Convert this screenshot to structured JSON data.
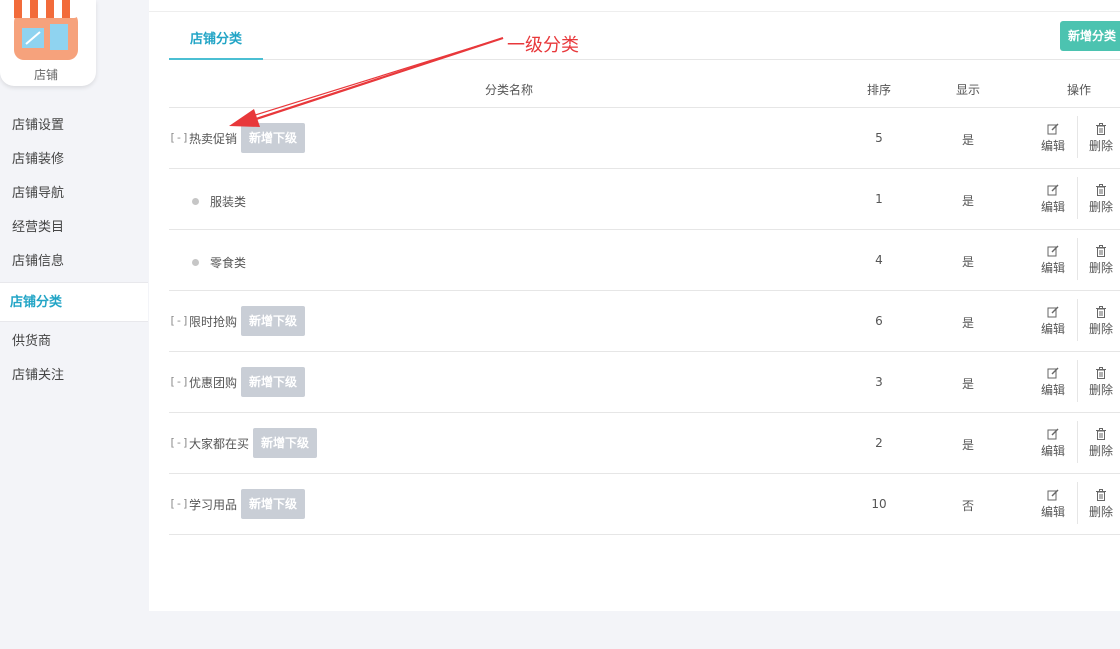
{
  "sidebar": {
    "shop_name": "店铺",
    "items": [
      {
        "label": "店铺设置",
        "active": false
      },
      {
        "label": "店铺装修",
        "active": false
      },
      {
        "label": "店铺导航",
        "active": false
      },
      {
        "label": "经营类目",
        "active": false
      },
      {
        "label": "店铺信息",
        "active": false
      },
      {
        "label": "店铺分类",
        "active": true
      },
      {
        "label": "供货商",
        "active": false
      },
      {
        "label": "店铺关注",
        "active": false
      }
    ]
  },
  "main": {
    "tab_label": "店铺分类",
    "add_category_button": "新增分类",
    "annotation": "一级分类",
    "table": {
      "headers": {
        "name": "分类名称",
        "sort": "排序",
        "show": "显示",
        "op": "操作"
      },
      "add_child_label": "新增下级",
      "edit_label": "编辑",
      "delete_label": "删除",
      "collapse_symbol": "[-]",
      "rows": [
        {
          "name": "热卖促销",
          "sort": "5",
          "show": "是",
          "level": 1
        },
        {
          "name": "服装类",
          "sort": "1",
          "show": "是",
          "level": 2
        },
        {
          "name": "零食类",
          "sort": "4",
          "show": "是",
          "level": 2
        },
        {
          "name": "限时抢购",
          "sort": "6",
          "show": "是",
          "level": 1
        },
        {
          "name": "优惠团购",
          "sort": "3",
          "show": "是",
          "level": 1
        },
        {
          "name": "大家都在买",
          "sort": "2",
          "show": "是",
          "level": 1
        },
        {
          "name": "学习用品",
          "sort": "10",
          "show": "否",
          "level": 1
        }
      ]
    }
  },
  "colors": {
    "accent": "#23a5c6",
    "add_button": "#4cc3b0",
    "child_button": "#c9ced6",
    "annotation": "#e8383b"
  },
  "icons": {
    "edit": "edit-icon",
    "delete": "trash-icon",
    "logo": "shop-storefront-icon"
  }
}
